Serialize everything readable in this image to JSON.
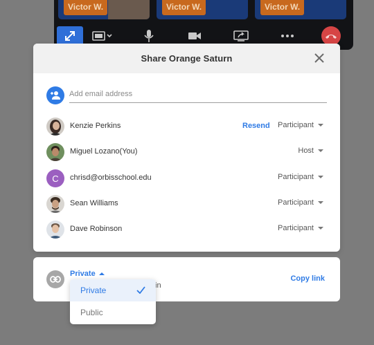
{
  "call": {
    "tiles": [
      {
        "name": "Victor W."
      },
      {
        "name": "Victor W."
      },
      {
        "name": "Victor W."
      }
    ],
    "controls": [
      {
        "icon": "fullscreen-icon"
      },
      {
        "icon": "layout-icon"
      },
      {
        "icon": "microphone-icon"
      },
      {
        "icon": "camera-icon"
      },
      {
        "icon": "screen-share-icon"
      },
      {
        "icon": "more-icon"
      },
      {
        "icon": "hang-up-icon"
      }
    ],
    "colors": {
      "accent": "#2f6fd8",
      "end_call": "#d64545",
      "name_tag": "#c8691e"
    }
  },
  "dialog": {
    "title": "Share Orange Saturn",
    "email_placeholder": "Add email address",
    "members": [
      {
        "name": "Kenzie Perkins",
        "role": "Participant",
        "action": "Resend",
        "avatar": "photo"
      },
      {
        "name": "Miguel Lozano(You)",
        "role": "Host",
        "avatar": "photo"
      },
      {
        "name": "chrisd@orbisschool.edu",
        "role": "Participant",
        "avatar": "letter",
        "initial": "C"
      },
      {
        "name": "Sean Williams",
        "role": "Participant",
        "avatar": "photo"
      },
      {
        "name": "Dave Robinson",
        "role": "Participant",
        "avatar": "photo"
      }
    ]
  },
  "link_sharing": {
    "privacy": "Private",
    "description_tail": "in",
    "copy_label": "Copy link"
  },
  "privacy_menu": {
    "options": [
      {
        "label": "Private",
        "selected": true
      },
      {
        "label": "Public",
        "selected": false
      }
    ]
  }
}
